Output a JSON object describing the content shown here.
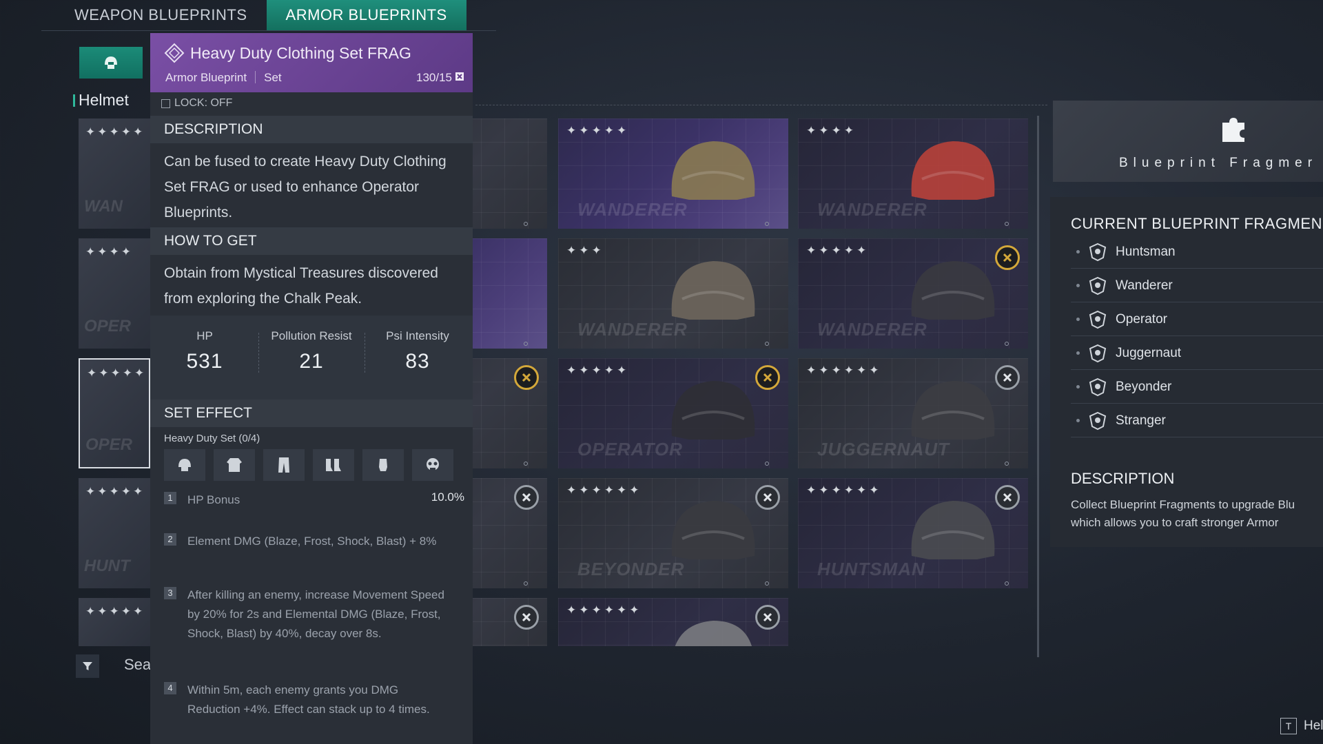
{
  "tabs": {
    "weapon": "WEAPON BLUEPRINTS",
    "armor": "ARMOR BLUEPRINTS"
  },
  "left": {
    "category": "Helmet",
    "cards": [
      {
        "stars": "✦✦✦✦✦",
        "brand": "WAN"
      },
      {
        "stars": "✦✦✦✦",
        "brand": "OPER"
      },
      {
        "stars": "✦✦✦✦✦",
        "brand": "OPER"
      },
      {
        "stars": "✦✦✦✦✦",
        "brand": "HUNT"
      },
      {
        "stars": "✦✦✦✦✦",
        "brand": ""
      }
    ],
    "search_text": "Sea"
  },
  "detail": {
    "title": "Heavy Duty Clothing Set FRAG",
    "type": "Armor Blueprint",
    "kind": "Set",
    "count": "130/15",
    "lock": "LOCK: OFF",
    "description_head": "DESCRIPTION",
    "description": "Can be fused to create Heavy Duty Clothing Set FRAG or used to enhance Operator Blueprints.",
    "how_head": "HOW TO GET",
    "how": "Obtain from Mystical Treasures discovered from exploring the Chalk Peak.",
    "stats": [
      {
        "label": "HP",
        "value": "531"
      },
      {
        "label": "Pollution Resist",
        "value": "21"
      },
      {
        "label": "Psi Intensity",
        "value": "83"
      }
    ],
    "set_head": "SET EFFECT",
    "set_label": "Heavy Duty Set (0/4)",
    "set_icons": [
      "helmet-icon",
      "chest-icon",
      "pants-icon",
      "boots-icon",
      "gloves-icon",
      "mask-icon"
    ],
    "effects": [
      {
        "num": "1",
        "text": "HP Bonus",
        "pct": "10.0%"
      },
      {
        "num": "2",
        "text": "Element DMG (Blaze, Frost, Shock, Blast) + 8%",
        "pct": ""
      },
      {
        "num": "3",
        "text": "After killing an enemy, increase Movement Speed by 20% for 2s and Elemental DMG (Blaze, Frost, Shock, Blast) by 40%, decay over 8s.",
        "pct": ""
      },
      {
        "num": "4",
        "text": "Within 5m, each enemy grants you DMG Reduction +4%. Effect can stack up to 4 times.",
        "pct": ""
      }
    ]
  },
  "grid": [
    {
      "stars": "",
      "brand": "",
      "badge": ""
    },
    {
      "stars": "✦✦✦✦✦",
      "brand": "WANDERER",
      "badge": ""
    },
    {
      "stars": "✦✦✦✦",
      "brand": "WANDERER",
      "badge": ""
    },
    {
      "stars": "",
      "brand": "",
      "badge": ""
    },
    {
      "stars": "✦✦✦",
      "brand": "WANDERER",
      "badge": ""
    },
    {
      "stars": "✦✦✦✦✦",
      "brand": "WANDERER",
      "badge": "gold"
    },
    {
      "stars": "",
      "brand": "",
      "badge": "gold"
    },
    {
      "stars": "✦✦✦✦✦",
      "brand": "OPERATOR",
      "badge": "gold"
    },
    {
      "stars": "✦✦✦✦✦✦",
      "brand": "JUGGERNAUT",
      "badge": "grey"
    },
    {
      "stars": "",
      "brand": "",
      "badge": "grey"
    },
    {
      "stars": "✦✦✦✦✦✦",
      "brand": "BEYONDER",
      "badge": "grey"
    },
    {
      "stars": "✦✦✦✦✦✦",
      "brand": "HUNTSMAN",
      "badge": "grey"
    },
    {
      "stars": "",
      "brand": "",
      "badge": "grey"
    },
    {
      "stars": "✦✦✦✦✦✦",
      "brand": "",
      "badge": "grey"
    }
  ],
  "right": {
    "frag_title": "Blueprint Fragmer",
    "current_head": "CURRENT BLUEPRINT FRAGMEN",
    "items": [
      "Huntsman",
      "Wanderer",
      "Operator",
      "Juggernaut",
      "Beyonder",
      "Stranger"
    ],
    "desc_head": "DESCRIPTION",
    "desc_line1": "Collect Blueprint Fragments to upgrade Blu",
    "desc_line2": "which allows you to craft stronger Armor"
  },
  "help": {
    "key": "T",
    "label": "Hel"
  },
  "colors": {
    "accent_teal": "#1f8f7c",
    "header_purple": "#6b4596",
    "badge_gold": "#d4a83a"
  }
}
